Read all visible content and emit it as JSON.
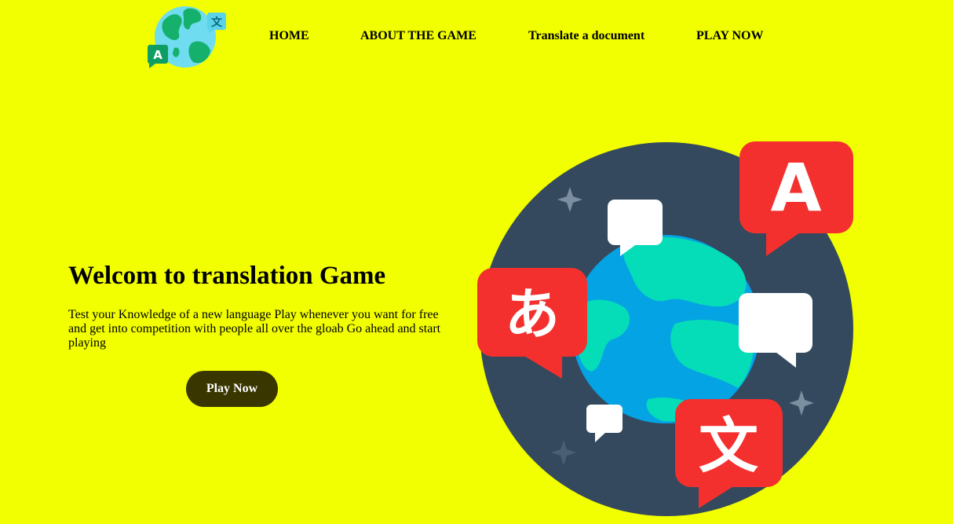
{
  "nav": {
    "home": "HOME",
    "about": "ABOUT THE GAME",
    "translate": "Translate a document",
    "play": "PLAY NOW"
  },
  "logo": {
    "glyph_a": "A",
    "glyph_wen": "文"
  },
  "hero": {
    "title": "Welcom to translation Game",
    "description": "Test your Knowledge of a new language Play whenever you want for free and get into competition with people all over the gloab Go ahead and start playing",
    "button_label": "Play Now"
  },
  "illustration": {
    "bubble_a": "A",
    "bubble_hiragana": "あ",
    "bubble_wen": "文"
  },
  "colors": {
    "background": "#f2ff00",
    "button": "#3a3600",
    "bubble_red": "#f4302e",
    "ring": "#34495e",
    "ocean": "#03a3e4",
    "land": "#05dcb8"
  }
}
